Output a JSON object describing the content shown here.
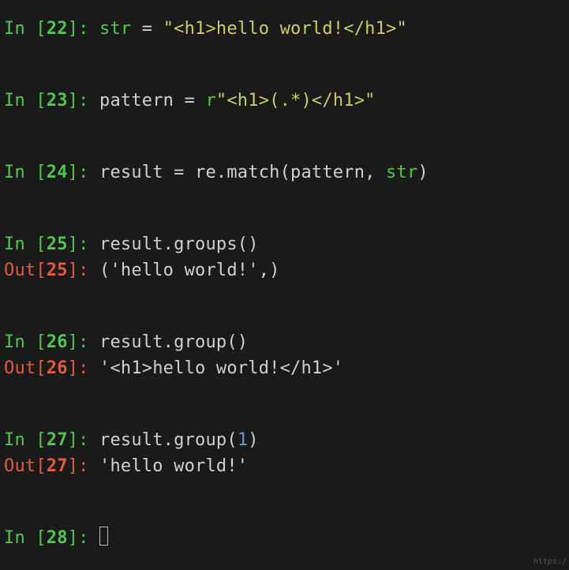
{
  "cells": [
    {
      "in_num": "22",
      "code_tokens": [
        {
          "t": "builtin",
          "v": "str"
        },
        {
          "t": "code",
          "v": " = "
        },
        {
          "t": "str",
          "v": "\"<h1>hello world!</h1>\""
        }
      ]
    },
    {
      "in_num": "23",
      "code_tokens": [
        {
          "t": "code",
          "v": "pattern = "
        },
        {
          "t": "kw",
          "v": "r"
        },
        {
          "t": "str",
          "v": "\"<h1>(.*)</h1>\""
        }
      ]
    },
    {
      "in_num": "24",
      "code_tokens": [
        {
          "t": "code",
          "v": "result = re.match(pattern, "
        },
        {
          "t": "builtin",
          "v": "str"
        },
        {
          "t": "code",
          "v": ")"
        }
      ]
    },
    {
      "in_num": "25",
      "code_tokens": [
        {
          "t": "code",
          "v": "result.groups()"
        }
      ],
      "out_num": "25",
      "out_val": "('hello world!',)"
    },
    {
      "in_num": "26",
      "code_tokens": [
        {
          "t": "code",
          "v": "result.group()"
        }
      ],
      "out_num": "26",
      "out_val": "'<h1>hello world!</h1>'"
    },
    {
      "in_num": "27",
      "code_tokens": [
        {
          "t": "code",
          "v": "result.group("
        },
        {
          "t": "num-lit",
          "v": "1"
        },
        {
          "t": "code",
          "v": ")"
        }
      ],
      "out_num": "27",
      "out_val": "'hello world!'"
    },
    {
      "in_num": "28",
      "cursor": true
    }
  ],
  "prompt_in_prefix": "In [",
  "prompt_in_suffix": "]: ",
  "prompt_out_prefix": "Out[",
  "prompt_out_suffix": "]: ",
  "watermark": "https:/"
}
